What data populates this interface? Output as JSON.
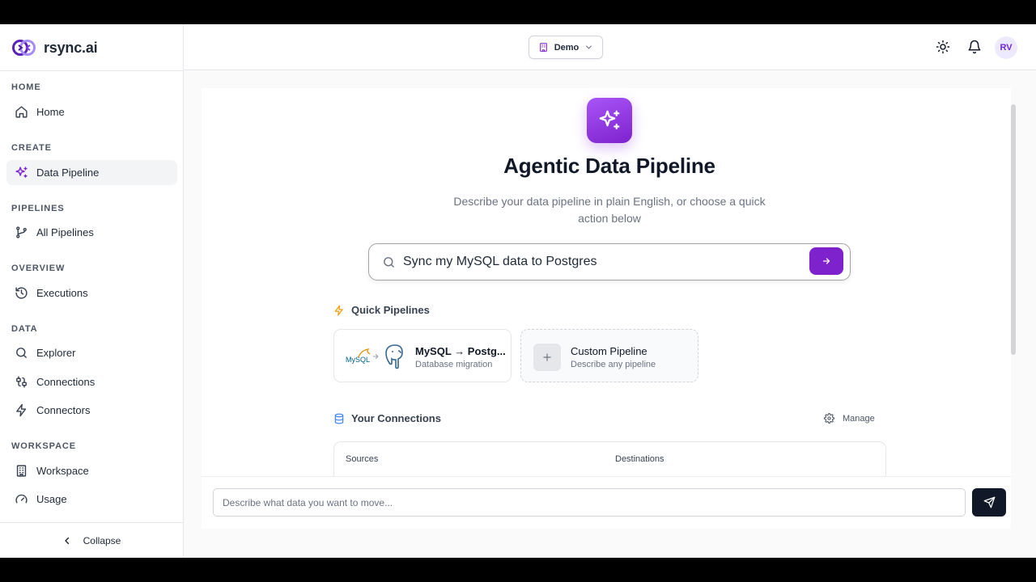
{
  "app": {
    "name": "rsync.ai"
  },
  "sidebar": {
    "sections": [
      {
        "label": "HOME",
        "items": [
          {
            "label": "Home",
            "icon": "home-icon"
          }
        ]
      },
      {
        "label": "CREATE",
        "items": [
          {
            "label": "Data Pipeline",
            "icon": "sparkles-icon",
            "active": true
          }
        ]
      },
      {
        "label": "PIPELINES",
        "items": [
          {
            "label": "All Pipelines",
            "icon": "git-branch-icon"
          }
        ]
      },
      {
        "label": "OVERVIEW",
        "items": [
          {
            "label": "Executions",
            "icon": "history-icon"
          }
        ]
      },
      {
        "label": "DATA",
        "items": [
          {
            "label": "Explorer",
            "icon": "search-icon"
          },
          {
            "label": "Connections",
            "icon": "cable-icon"
          },
          {
            "label": "Connectors",
            "icon": "zap-icon"
          }
        ]
      },
      {
        "label": "WORKSPACE",
        "items": [
          {
            "label": "Workspace",
            "icon": "building-icon"
          },
          {
            "label": "Usage",
            "icon": "gauge-icon"
          }
        ]
      }
    ],
    "collapse_label": "Collapse"
  },
  "header": {
    "org_label": "Demo",
    "avatar_initials": "RV"
  },
  "hero": {
    "title": "Agentic Data Pipeline",
    "subtitle": "Describe your data pipeline in plain English, or choose a quick action below"
  },
  "search": {
    "value": "Sync my MySQL data to Postgres"
  },
  "quick_pipelines": {
    "heading": "Quick Pipelines",
    "cards": [
      {
        "title": "MySQL → Postg...",
        "desc": "Database migration",
        "logo_text": "MySQL"
      },
      {
        "title": "Custom Pipeline",
        "desc": "Describe any pipeline"
      }
    ]
  },
  "connections": {
    "heading": "Your Connections",
    "manage_label": "Manage",
    "columns": [
      "Sources",
      "Destinations"
    ]
  },
  "chat": {
    "placeholder": "Describe what data you want to move..."
  },
  "colors": {
    "accent": "#7e22ce",
    "accent_light": "#a855f7",
    "dark_button": "#111827"
  }
}
